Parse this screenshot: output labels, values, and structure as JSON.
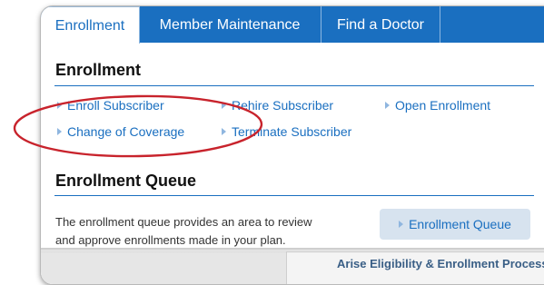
{
  "tabs": [
    {
      "label": "Enrollment",
      "active": true
    },
    {
      "label": "Member Maintenance",
      "active": false
    },
    {
      "label": "Find a Doctor",
      "active": false
    }
  ],
  "enrollment": {
    "heading": "Enrollment",
    "links": {
      "enroll": "Enroll Subscriber",
      "rehire": "Rehire Subscriber",
      "open": "Open Enrollment",
      "change": "Change of Coverage",
      "terminate": "Terminate Subscriber"
    }
  },
  "queue": {
    "heading": "Enrollment Queue",
    "description_line1": "The enrollment queue provides an area to review",
    "description_line2": "and approve enrollments made in your plan.",
    "button": "Enrollment Queue"
  },
  "bottom_text": "Arise Eligibility & Enrollment Process",
  "colors": {
    "tab_bar": "#1a6fc0",
    "link": "#1a6fc0",
    "annotation": "#c8232c"
  }
}
